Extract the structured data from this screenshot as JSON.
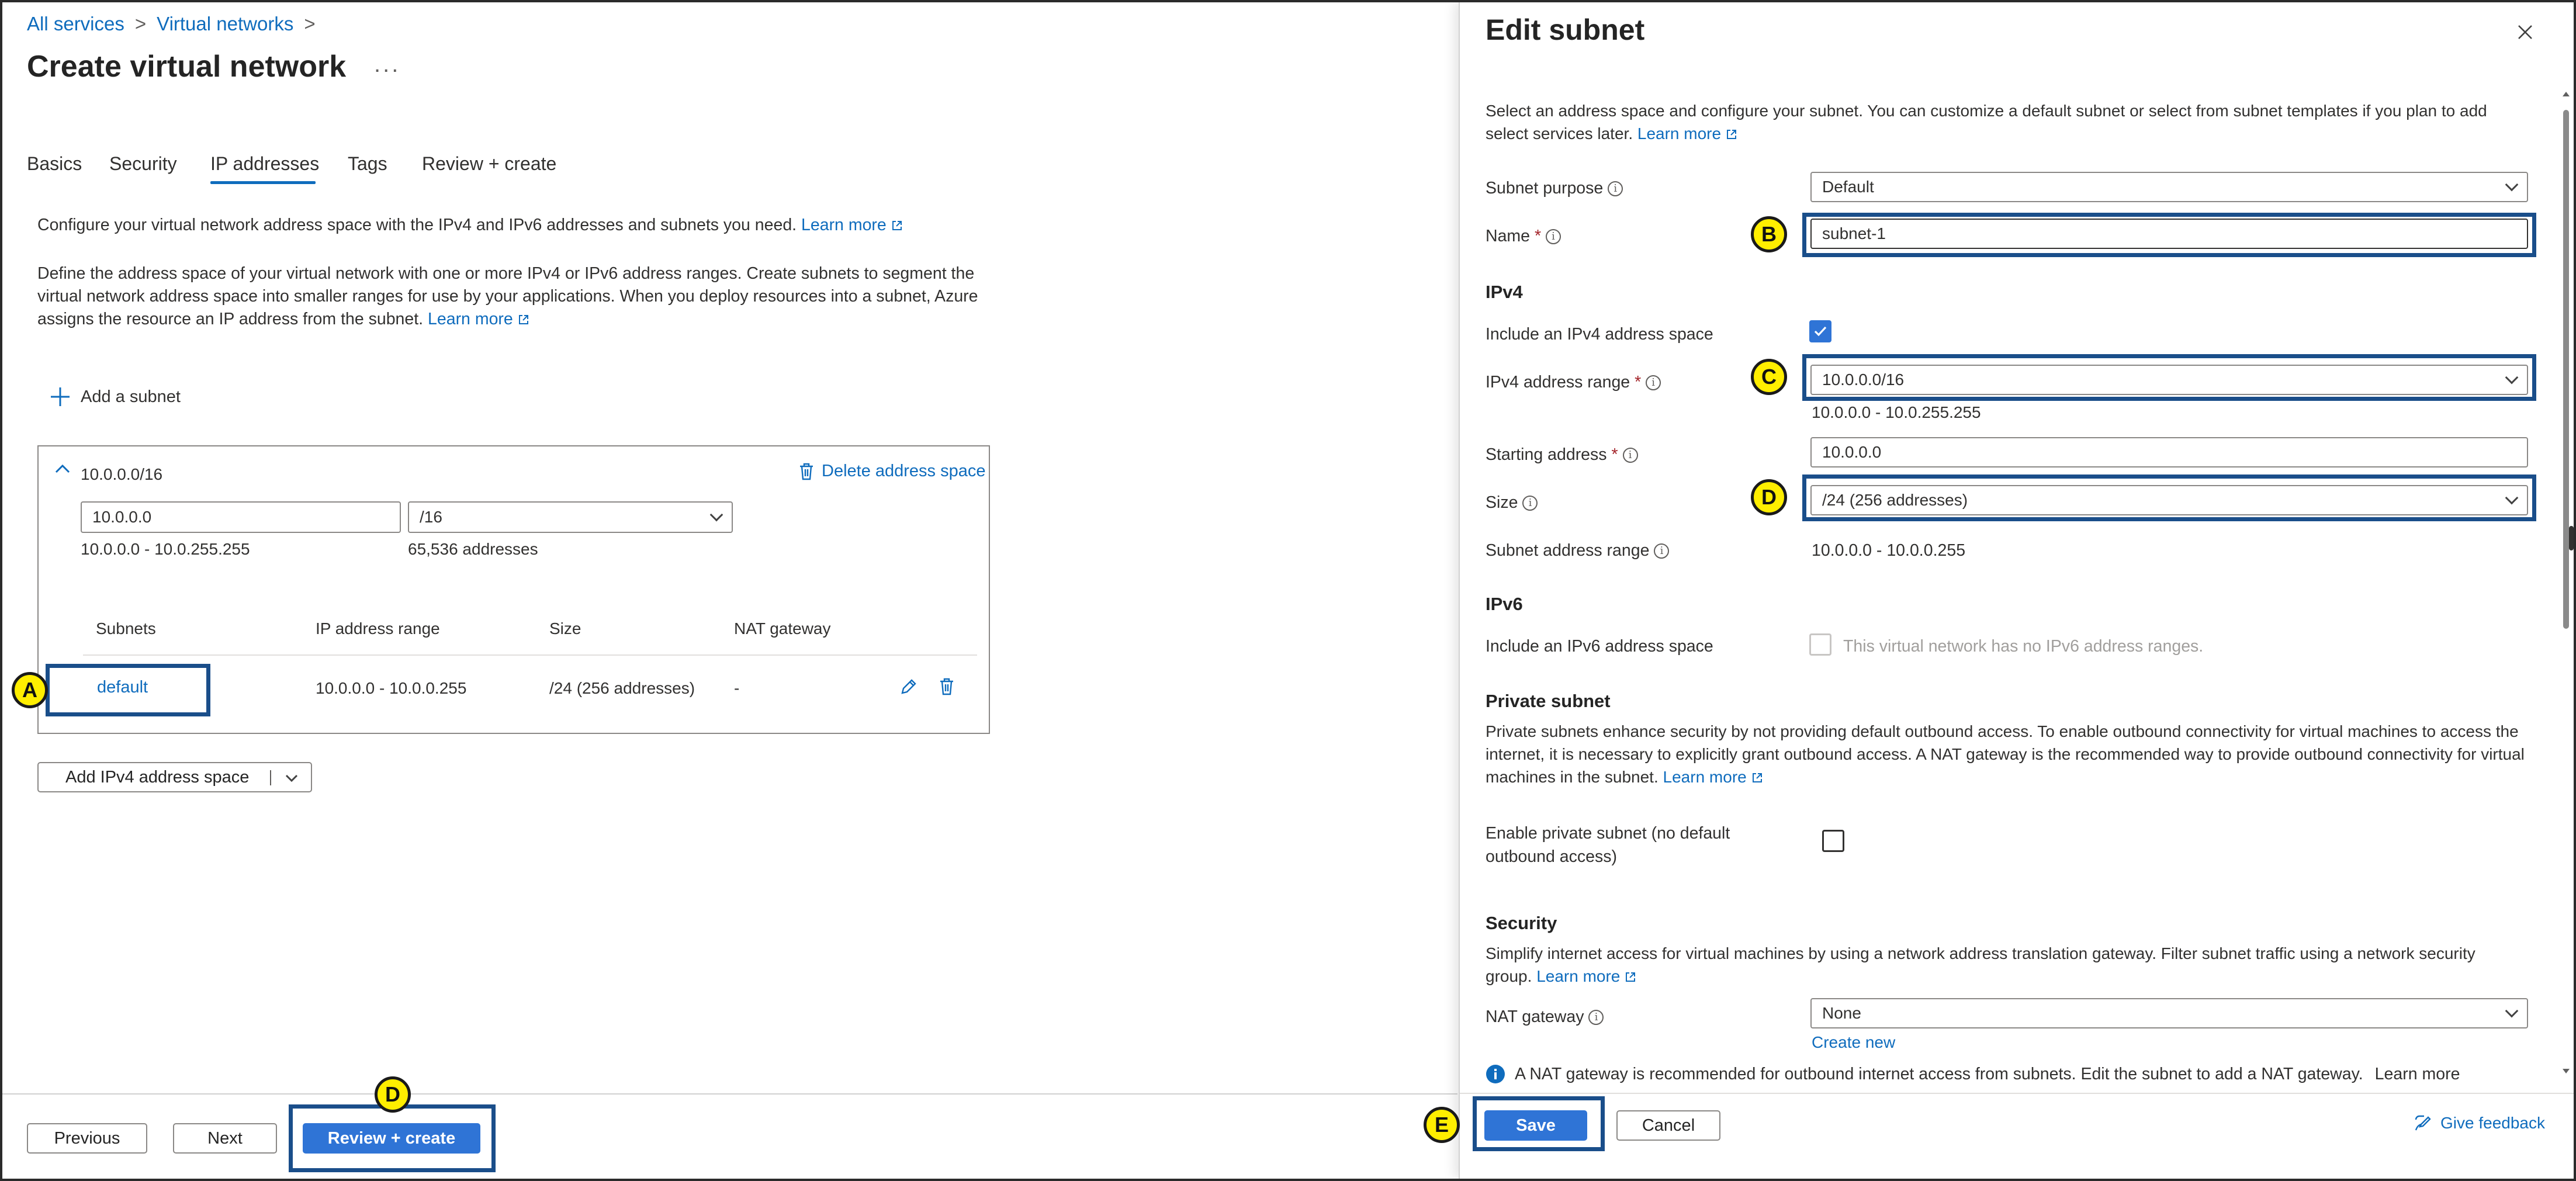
{
  "breadcrumb": {
    "items": [
      "All services",
      "Virtual networks"
    ]
  },
  "page": {
    "title": "Create virtual network",
    "more": "..."
  },
  "tabs": [
    "Basics",
    "Security",
    "IP addresses",
    "Tags",
    "Review + create"
  ],
  "intro": {
    "line1": "Configure your virtual network address space with the IPv4 and IPv6 addresses and subnets you need.",
    "line1_link": "Learn more",
    "line2": "Define the address space of your virtual network with one or more IPv4 or IPv6 address ranges. Create subnets to segment the virtual network address space into smaller ranges for use by your applications. When you deploy resources into a subnet, Azure assigns the resource an IP address from the subnet.",
    "line2_link": "Learn more"
  },
  "add_subnet": "Add a subnet",
  "address_space": {
    "header": "10.0.0.0/16",
    "delete_label": "Delete address space",
    "address_value": "10.0.0.0",
    "prefix_value": "/16",
    "range": "10.0.0.0 - 10.0.255.255",
    "count": "65,536 addresses",
    "columns": [
      "Subnets",
      "IP address range",
      "Size",
      "NAT gateway"
    ],
    "rows": [
      {
        "subnet": "default",
        "range": "10.0.0.0 - 10.0.0.255",
        "size": "/24 (256 addresses)",
        "nat": "-"
      }
    ]
  },
  "add_ipv4_button": "Add IPv4 address space",
  "footer_left": {
    "previous": "Previous",
    "next": "Next",
    "review": "Review + create"
  },
  "panel": {
    "title": "Edit subnet",
    "description": "Select an address space and configure your subnet. You can customize a default subnet or select from subnet templates if you plan to add select services later.",
    "description_link": "Learn more",
    "subnet_purpose": {
      "label": "Subnet purpose",
      "value": "Default"
    },
    "name": {
      "label": "Name",
      "value": "subnet-1"
    },
    "ipv4_section": "IPv4",
    "include_ipv4": {
      "label": "Include an IPv4 address space",
      "checked": true
    },
    "ipv4_range": {
      "label": "IPv4 address range",
      "value": "10.0.0.0/16",
      "hint": "10.0.0.0 - 10.0.255.255"
    },
    "starting_address": {
      "label": "Starting address",
      "value": "10.0.0.0"
    },
    "size": {
      "label": "Size",
      "value": "/24 (256 addresses)"
    },
    "subnet_range": {
      "label": "Subnet address range",
      "value": "10.0.0.0 - 10.0.0.255"
    },
    "ipv6_section": "IPv6",
    "include_ipv6": {
      "label": "Include an IPv6 address space",
      "note": "This virtual network has no IPv6 address ranges."
    },
    "private_section": "Private subnet",
    "private_text": "Private subnets enhance security by not providing default outbound access. To enable outbound connectivity for virtual machines to access the internet, it is necessary to explicitly grant outbound access. A NAT gateway is the recommended way to provide outbound connectivity for virtual machines in the subnet.",
    "private_link": "Learn more",
    "enable_private": {
      "label_line1": "Enable private subnet (no default",
      "label_line2": "outbound access)",
      "checked": false
    },
    "security_section": "Security",
    "security_text_1": "Simplify internet access for virtual machines by using a network address translation gateway. Filter subnet traffic using a network security",
    "security_text_2": "group.",
    "security_link": "Learn more",
    "nat_gateway": {
      "label": "NAT gateway",
      "value": "None",
      "create_new": "Create new"
    },
    "nat_info": "A NAT gateway is recommended for outbound internet access from subnets. Edit the subnet to add a NAT gateway.",
    "nat_info_link": "Learn more",
    "save": "Save",
    "cancel": "Cancel",
    "feedback": "Give feedback"
  },
  "callouts": {
    "a": "A",
    "b": "B",
    "c": "C",
    "d_left": "D",
    "d_right": "D",
    "e": "E"
  },
  "colors": {
    "accent": "#0f6cbd",
    "primary_button": "#2f74d6",
    "callout_border": "#1a4e8a",
    "badge": "#ffee00"
  }
}
